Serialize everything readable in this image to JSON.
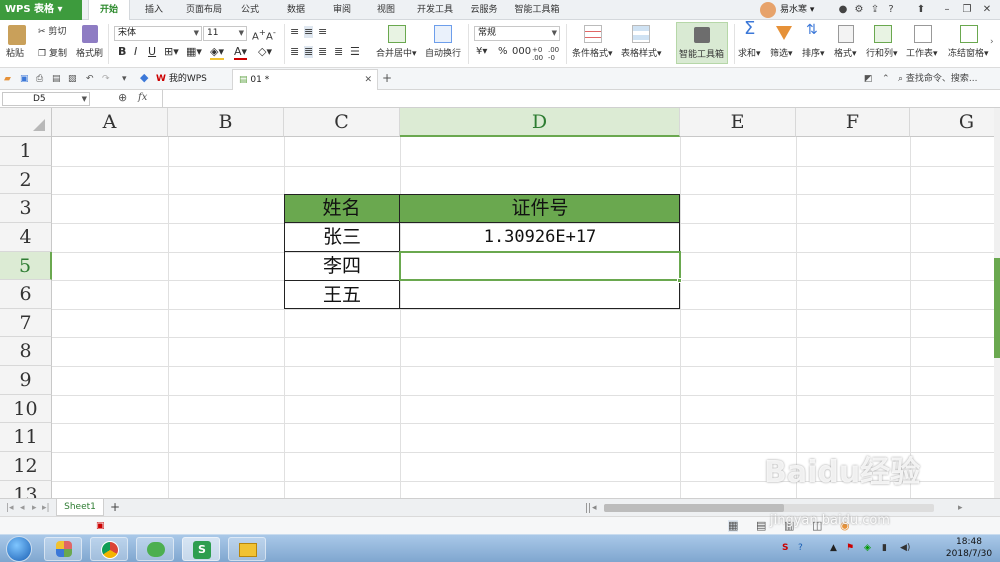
{
  "app": {
    "logo": "WPS 表格"
  },
  "menu": {
    "tabs": [
      "开始",
      "插入",
      "页面布局",
      "公式",
      "数据",
      "审阅",
      "视图",
      "开发工具",
      "云服务",
      "智能工具箱"
    ],
    "active": "开始",
    "user": "易水寒"
  },
  "ribbon": {
    "paste": "粘贴",
    "cut": "剪切",
    "copy": "复制",
    "format_painter": "格式刷",
    "font_name": "宋体",
    "font_size": "11",
    "merge_center": "合并居中",
    "wrap_text": "自动换行",
    "number_format": "常规",
    "conditional_format": "条件格式",
    "table_style": "表格样式",
    "smart_toolbox": "智能工具箱",
    "sum": "求和",
    "filter": "筛选",
    "sort": "排序",
    "format": "格式",
    "row_col": "行和列",
    "worksheet": "工作表",
    "freeze": "冻结窗格"
  },
  "quick_access": {
    "my_wps": "我的WPS",
    "doc_tab": "01 *",
    "search": "查找命令、搜索..."
  },
  "formula_bar": {
    "name_box": "D5",
    "fx": "fx",
    "value": ""
  },
  "sheet": {
    "columns": [
      "A",
      "B",
      "C",
      "D",
      "E",
      "F",
      "G"
    ],
    "selected_column": "D",
    "rows": [
      "1",
      "2",
      "3",
      "4",
      "5",
      "6",
      "7",
      "8",
      "9",
      "10",
      "11",
      "12",
      "13"
    ],
    "selected_row": "5",
    "header": {
      "name": "姓名",
      "id": "证件号"
    },
    "data": [
      {
        "name": "张三",
        "id": "1.30926E+17"
      },
      {
        "name": "李四",
        "id": ""
      },
      {
        "name": "王五",
        "id": ""
      }
    ],
    "header_color": "#6aa84f"
  },
  "sheet_tabs": {
    "active": "Sheet1",
    "add": "+"
  },
  "status": {
    "zoom_icons": ""
  },
  "taskbar": {
    "time": "18:48",
    "date": "2018/7/30",
    "watermark": "Baidu经验",
    "watermark_url": "jingyan.baidu.com"
  }
}
